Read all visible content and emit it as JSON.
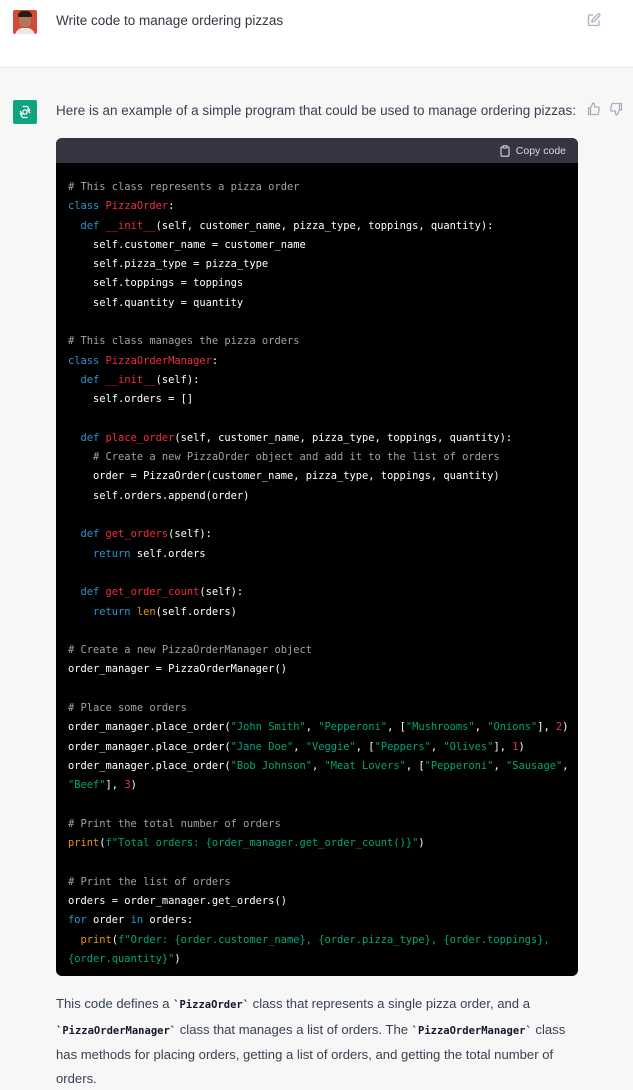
{
  "user_message": {
    "text": "Write code to manage ordering pizzas",
    "avatar": "user-avatar",
    "edit_icon": "edit-icon"
  },
  "assistant_message": {
    "intro": "Here is an example of a simple program that could be used to manage ordering pizzas:",
    "avatar": "openai-logo-icon",
    "avatar_color": "#10a37f",
    "copy_label": "Copy code",
    "code_lines": [
      [
        {
          "t": "cm",
          "v": "# This class represents a pizza order"
        }
      ],
      [
        {
          "t": "kw",
          "v": "class "
        },
        {
          "t": "cls",
          "v": "PizzaOrder"
        },
        {
          "t": "pl",
          "v": ":"
        }
      ],
      [
        {
          "t": "pl",
          "v": "  "
        },
        {
          "t": "kw",
          "v": "def "
        },
        {
          "t": "cls",
          "v": "__init__"
        },
        {
          "t": "pl",
          "v": "(self, customer_name, pizza_type, toppings, quantity):"
        }
      ],
      [
        {
          "t": "pl",
          "v": "    self.customer_name = customer_name"
        }
      ],
      [
        {
          "t": "pl",
          "v": "    self.pizza_type = pizza_type"
        }
      ],
      [
        {
          "t": "pl",
          "v": "    self.toppings = toppings"
        }
      ],
      [
        {
          "t": "pl",
          "v": "    self.quantity = quantity"
        }
      ],
      [],
      [
        {
          "t": "cm",
          "v": "# This class manages the pizza orders"
        }
      ],
      [
        {
          "t": "kw",
          "v": "class "
        },
        {
          "t": "cls",
          "v": "PizzaOrderManager"
        },
        {
          "t": "pl",
          "v": ":"
        }
      ],
      [
        {
          "t": "pl",
          "v": "  "
        },
        {
          "t": "kw",
          "v": "def "
        },
        {
          "t": "cls",
          "v": "__init__"
        },
        {
          "t": "pl",
          "v": "(self):"
        }
      ],
      [
        {
          "t": "pl",
          "v": "    self.orders = []"
        }
      ],
      [],
      [
        {
          "t": "pl",
          "v": "  "
        },
        {
          "t": "kw",
          "v": "def "
        },
        {
          "t": "cls",
          "v": "place_order"
        },
        {
          "t": "pl",
          "v": "(self, customer_name, pizza_type, toppings, quantity):"
        }
      ],
      [
        {
          "t": "pl",
          "v": "    "
        },
        {
          "t": "cm",
          "v": "# Create a new PizzaOrder object and add it to the list of orders"
        }
      ],
      [
        {
          "t": "pl",
          "v": "    order = PizzaOrder(customer_name, pizza_type, toppings, quantity)"
        }
      ],
      [
        {
          "t": "pl",
          "v": "    self.orders.append(order)"
        }
      ],
      [],
      [
        {
          "t": "pl",
          "v": "  "
        },
        {
          "t": "kw",
          "v": "def "
        },
        {
          "t": "cls",
          "v": "get_orders"
        },
        {
          "t": "pl",
          "v": "(self):"
        }
      ],
      [
        {
          "t": "pl",
          "v": "    "
        },
        {
          "t": "kw",
          "v": "return "
        },
        {
          "t": "pl",
          "v": "self.orders"
        }
      ],
      [],
      [
        {
          "t": "pl",
          "v": "  "
        },
        {
          "t": "kw",
          "v": "def "
        },
        {
          "t": "cls",
          "v": "get_order_count"
        },
        {
          "t": "pl",
          "v": "(self):"
        }
      ],
      [
        {
          "t": "pl",
          "v": "    "
        },
        {
          "t": "kw",
          "v": "return "
        },
        {
          "t": "bi",
          "v": "len"
        },
        {
          "t": "pl",
          "v": "(self.orders)"
        }
      ],
      [],
      [
        {
          "t": "cm",
          "v": "# Create a new PizzaOrderManager object"
        }
      ],
      [
        {
          "t": "pl",
          "v": "order_manager = PizzaOrderManager()"
        }
      ],
      [],
      [
        {
          "t": "cm",
          "v": "# Place some orders"
        }
      ],
      [
        {
          "t": "pl",
          "v": "order_manager.place_order("
        },
        {
          "t": "str",
          "v": "\"John Smith\""
        },
        {
          "t": "pl",
          "v": ", "
        },
        {
          "t": "str",
          "v": "\"Pepperoni\""
        },
        {
          "t": "pl",
          "v": ", ["
        },
        {
          "t": "str",
          "v": "\"Mushrooms\""
        },
        {
          "t": "pl",
          "v": ", "
        },
        {
          "t": "str",
          "v": "\"Onions\""
        },
        {
          "t": "pl",
          "v": "], "
        },
        {
          "t": "num",
          "v": "2"
        },
        {
          "t": "pl",
          "v": ")"
        }
      ],
      [
        {
          "t": "pl",
          "v": "order_manager.place_order("
        },
        {
          "t": "str",
          "v": "\"Jane Doe\""
        },
        {
          "t": "pl",
          "v": ", "
        },
        {
          "t": "str",
          "v": "\"Veggie\""
        },
        {
          "t": "pl",
          "v": ", ["
        },
        {
          "t": "str",
          "v": "\"Peppers\""
        },
        {
          "t": "pl",
          "v": ", "
        },
        {
          "t": "str",
          "v": "\"Olives\""
        },
        {
          "t": "pl",
          "v": "], "
        },
        {
          "t": "num",
          "v": "1"
        },
        {
          "t": "pl",
          "v": ")"
        }
      ],
      [
        {
          "t": "pl",
          "v": "order_manager.place_order("
        },
        {
          "t": "str",
          "v": "\"Bob Johnson\""
        },
        {
          "t": "pl",
          "v": ", "
        },
        {
          "t": "str",
          "v": "\"Meat Lovers\""
        },
        {
          "t": "pl",
          "v": ", ["
        },
        {
          "t": "str",
          "v": "\"Pepperoni\""
        },
        {
          "t": "pl",
          "v": ", "
        },
        {
          "t": "str",
          "v": "\"Sausage\""
        },
        {
          "t": "pl",
          "v": ","
        }
      ],
      [
        {
          "t": "str",
          "v": "\"Beef\""
        },
        {
          "t": "pl",
          "v": "], "
        },
        {
          "t": "num",
          "v": "3"
        },
        {
          "t": "pl",
          "v": ")"
        }
      ],
      [],
      [
        {
          "t": "cm",
          "v": "# Print the total number of orders"
        }
      ],
      [
        {
          "t": "bi",
          "v": "print"
        },
        {
          "t": "pl",
          "v": "("
        },
        {
          "t": "str",
          "v": "f\"Total orders: {order_manager.get_order_count()}\""
        },
        {
          "t": "pl",
          "v": ")"
        }
      ],
      [],
      [
        {
          "t": "cm",
          "v": "# Print the list of orders"
        }
      ],
      [
        {
          "t": "pl",
          "v": "orders = order_manager.get_orders()"
        }
      ],
      [
        {
          "t": "kw",
          "v": "for "
        },
        {
          "t": "pl",
          "v": "order "
        },
        {
          "t": "kw",
          "v": "in "
        },
        {
          "t": "pl",
          "v": "orders:"
        }
      ],
      [
        {
          "t": "pl",
          "v": "  "
        },
        {
          "t": "bi",
          "v": "print"
        },
        {
          "t": "pl",
          "v": "("
        },
        {
          "t": "str",
          "v": "f\"Order: {order.customer_name}, {order.pizza_type}, {order.toppings},"
        }
      ],
      [
        {
          "t": "str",
          "v": "{order.quantity}\""
        },
        {
          "t": "pl",
          "v": ")"
        }
      ]
    ],
    "explanation": [
      {
        "t": "text",
        "v": "This code defines a "
      },
      {
        "t": "code",
        "v": "`PizzaOrder`"
      },
      {
        "t": "text",
        "v": " class that represents a single pizza order, and a "
      },
      {
        "t": "code",
        "v": "`PizzaOrderManager`"
      },
      {
        "t": "text",
        "v": " class that manages a list of orders. The "
      },
      {
        "t": "code",
        "v": "`PizzaOrderManager`"
      },
      {
        "t": "text",
        "v": " class has methods for placing orders, getting a list of orders, and getting the total number of orders."
      }
    ]
  },
  "colors": {
    "keyword": "#2e95d3",
    "class_name": "#f22c3d",
    "comment": "#a1a1aa",
    "string": "#00a67d",
    "number": "#df3079",
    "builtin": "#e9950c"
  }
}
